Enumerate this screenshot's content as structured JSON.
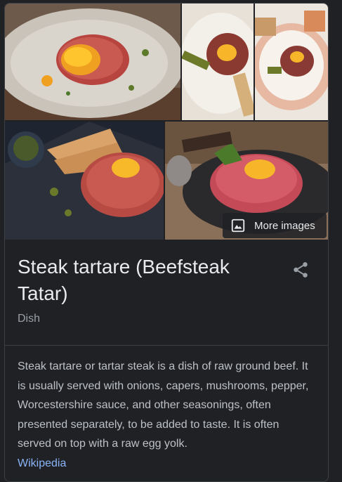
{
  "gallery": {
    "more_images_label": "More images"
  },
  "entity": {
    "title": "Steak tartare (Beefsteak Tatar)",
    "subtitle": "Dish"
  },
  "description": {
    "text": "Steak tartare or tartar steak is a dish of raw ground beef. It is usually served with onions, capers, mushrooms, pepper, Worcestershire sauce, and other seasonings, often presented separately, to be added to taste. It is often served on top with a raw egg yolk.",
    "source_link": "Wikipedia"
  },
  "colors": {
    "background": "#202124",
    "text_primary": "#e8eaed",
    "text_secondary": "#9aa0a6",
    "link": "#8ab4f8"
  },
  "icons": {
    "more_images": "image-icon",
    "share": "share-icon"
  }
}
